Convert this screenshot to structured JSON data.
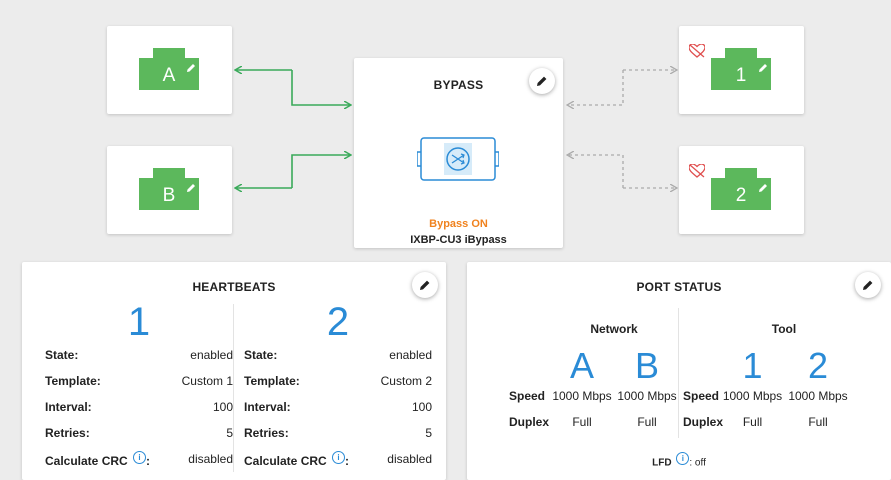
{
  "ports": {
    "network_a": {
      "label": "A"
    },
    "network_b": {
      "label": "B"
    },
    "tool_1": {
      "label": "1"
    },
    "tool_2": {
      "label": "2"
    }
  },
  "bypass": {
    "title": "BYPASS",
    "status": "Bypass ON",
    "model": "IXBP-CU3 iBypass"
  },
  "heartbeats": {
    "title": "HEARTBEATS",
    "columns": [
      {
        "number": "1",
        "state_label": "State:",
        "state": "enabled",
        "template_label": "Template:",
        "template": "Custom 1",
        "interval_label": "Interval:",
        "interval": "100",
        "retries_label": "Retries:",
        "retries": "5",
        "crc_label": "Calculate CRC",
        "crc": "disabled"
      },
      {
        "number": "2",
        "state_label": "State:",
        "state": "enabled",
        "template_label": "Template:",
        "template": "Custom 2",
        "interval_label": "Interval:",
        "interval": "100",
        "retries_label": "Retries:",
        "retries": "5",
        "crc_label": "Calculate CRC",
        "crc": "disabled"
      }
    ],
    "info_glyph": "i",
    "colon": ":"
  },
  "port_status": {
    "title": "PORT STATUS",
    "network": {
      "title": "Network",
      "ports": [
        "A",
        "B"
      ],
      "speed": [
        "1000 Mbps",
        "1000 Mbps"
      ],
      "duplex": [
        "Full",
        "Full"
      ]
    },
    "tool": {
      "title": "Tool",
      "ports": [
        "1",
        "2"
      ],
      "speed": [
        "1000 Mbps",
        "1000 Mbps"
      ],
      "duplex": [
        "Full",
        "Full"
      ]
    },
    "speed_label": "Speed",
    "duplex_label": "Duplex",
    "lfd_label": "LFD",
    "lfd_value": ": off"
  },
  "colors": {
    "port_green": "#5cb85c",
    "accent_blue": "#2a8bd6",
    "bypass_orange": "#f0821e",
    "heartbeat_red": "#e05050"
  },
  "icons": {
    "edit": "pencil-icon",
    "info": "info-icon",
    "heartbeat_off": "heart-broken-icon",
    "bypass": "bypass-switch-icon"
  }
}
